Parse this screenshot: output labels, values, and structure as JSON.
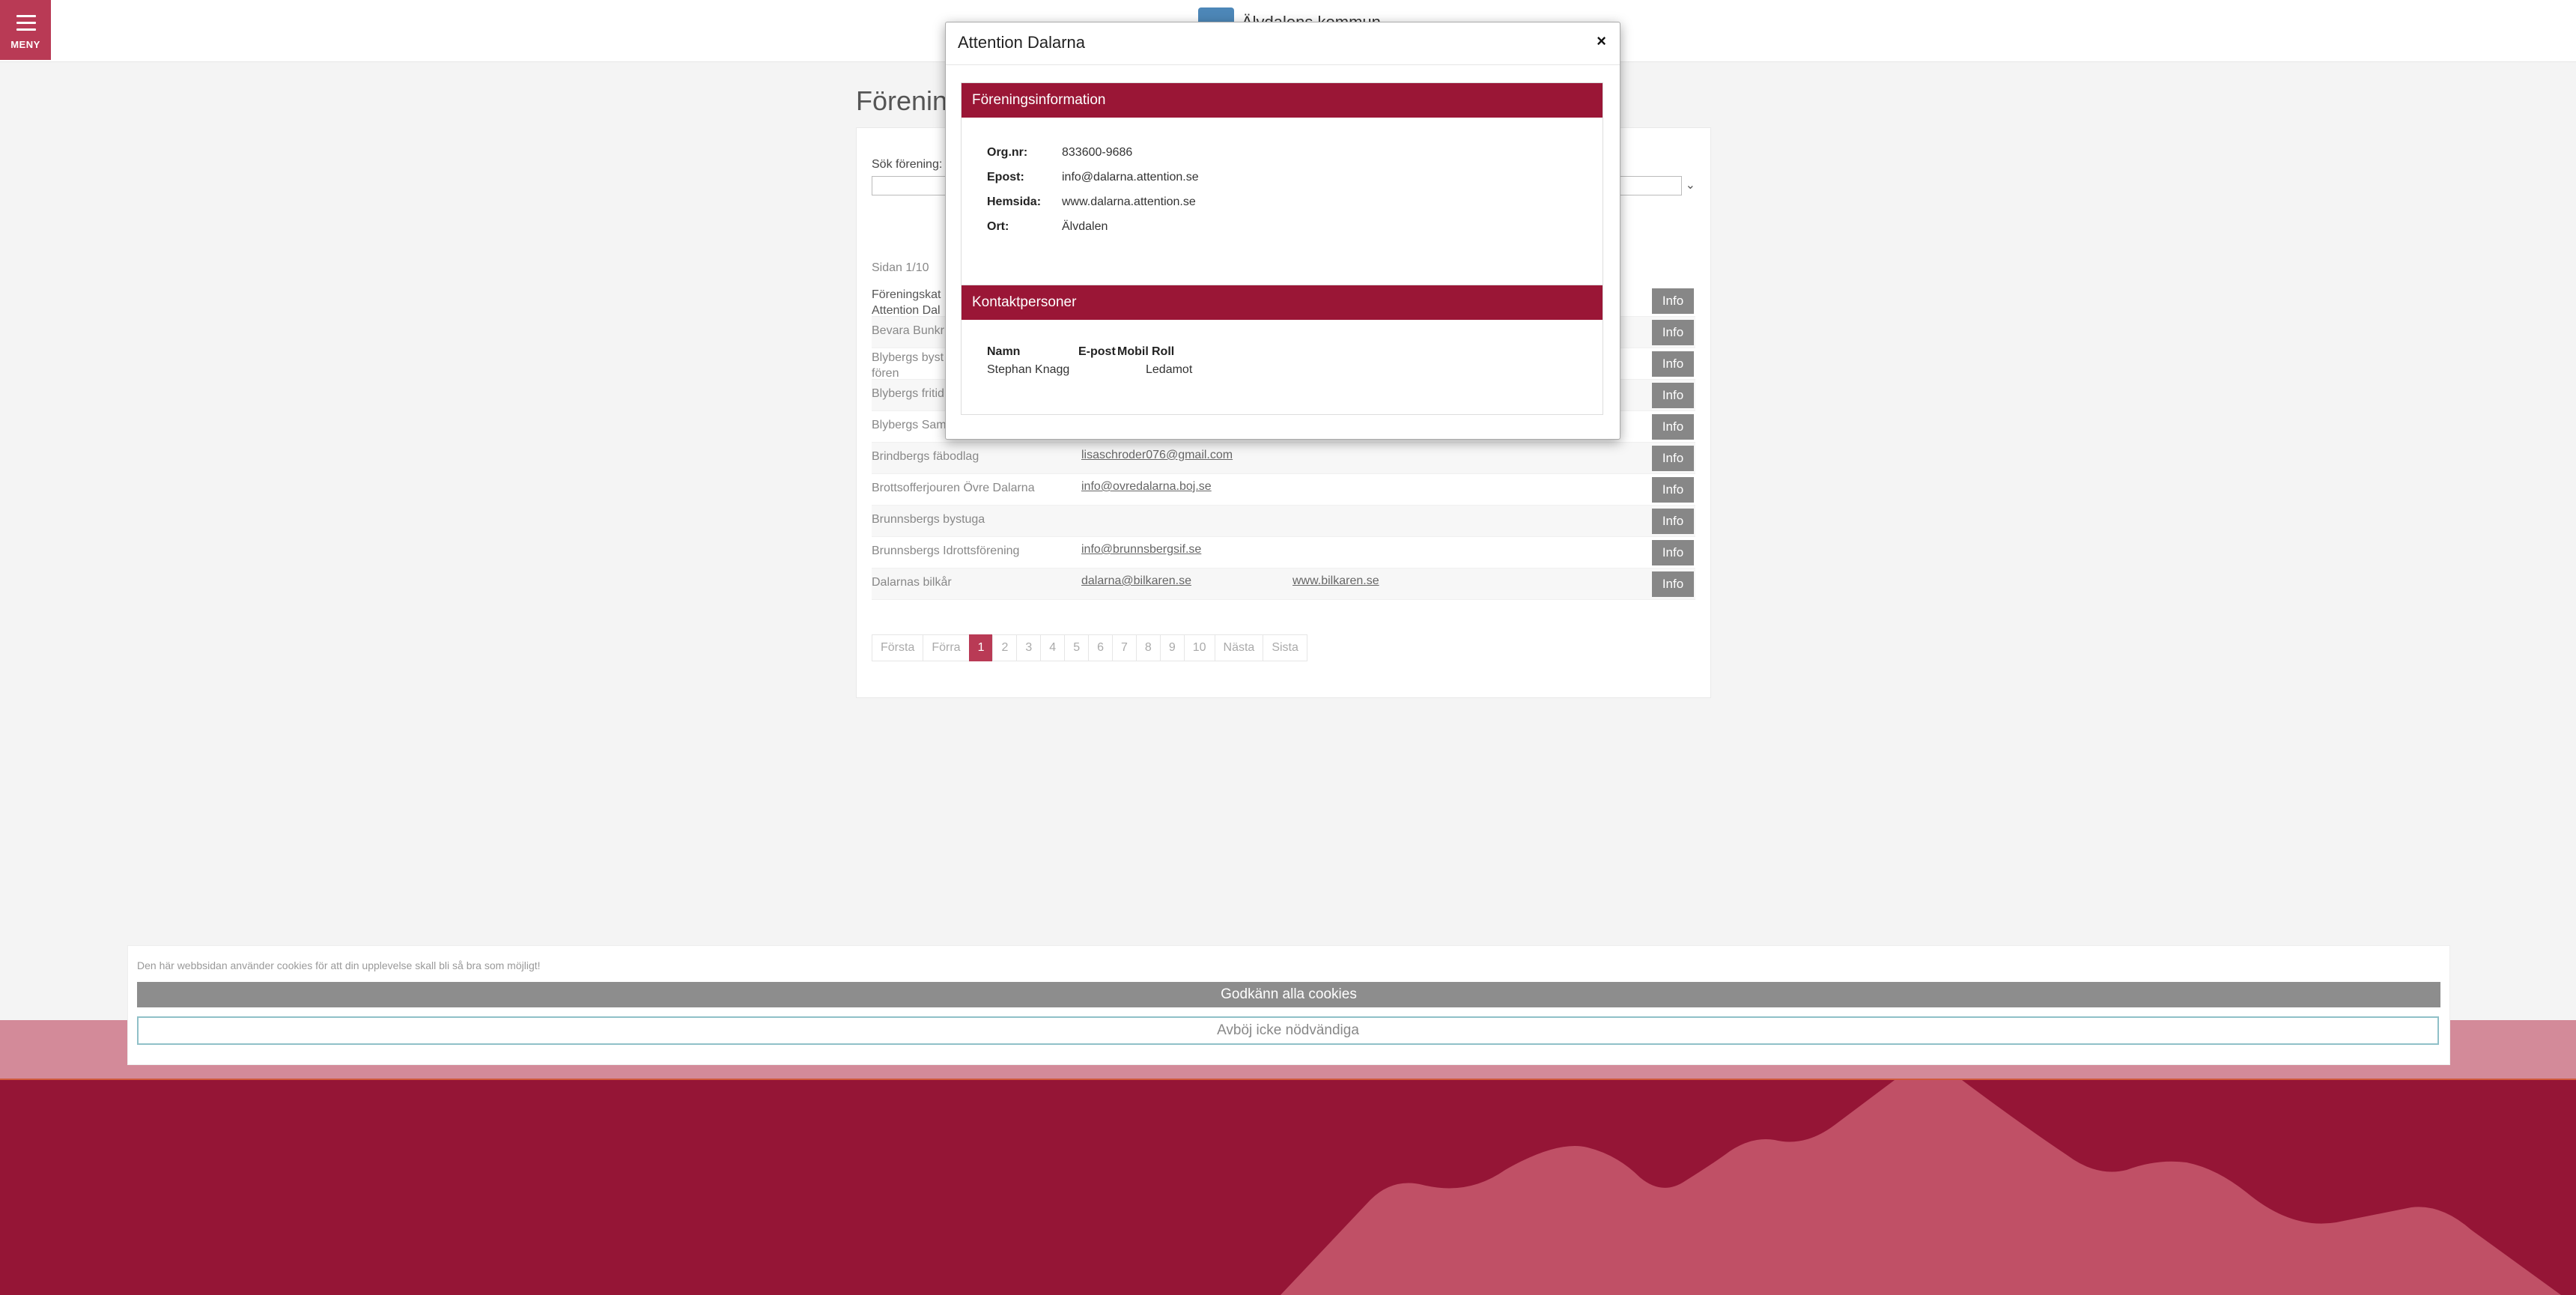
{
  "header": {
    "menu_label": "MENY",
    "logo_text": "Älvdalens kommun"
  },
  "page": {
    "title": "Förenin",
    "search_label": "Sök förening:",
    "page_count": "Sidan 1/10"
  },
  "list": {
    "info_label": "Info",
    "rows": [
      {
        "name": "Föreningskat\nAttention Dal",
        "email": "",
        "web": ""
      },
      {
        "name": "Bevara Bunkr",
        "email": "",
        "web": ""
      },
      {
        "name": "Blybergs byst\nfören",
        "email": "",
        "web": ""
      },
      {
        "name": "Blybergs fritid",
        "email": "",
        "web": ""
      },
      {
        "name": "Blybergs Samfällighetsförening",
        "email": "",
        "web": ""
      },
      {
        "name": "Brindbergs fäbodlag",
        "email": "lisaschroder076@gmail.com",
        "web": ""
      },
      {
        "name": "Brottsofferjouren Övre Dalarna",
        "email": "info@ovredalarna.boj.se",
        "web": ""
      },
      {
        "name": "Brunnsbergs bystuga",
        "email": "",
        "web": ""
      },
      {
        "name": "Brunnsbergs Idrottsförening",
        "email": "info@brunnsbergsif.se",
        "web": ""
      },
      {
        "name": "Dalarnas bilkår",
        "email": "dalarna@bilkaren.se",
        "web": "www.bilkaren.se"
      }
    ]
  },
  "pagination": [
    "Första",
    "Förra",
    "1",
    "2",
    "3",
    "4",
    "5",
    "6",
    "7",
    "8",
    "9",
    "10",
    "Nästa",
    "Sista"
  ],
  "modal": {
    "title": "Attention Dalarna",
    "close": "×",
    "info_heading": "Föreningsinformation",
    "org_label": "Org.nr:",
    "org_value": "833600-9686",
    "email_label": "Epost:",
    "email_value": "info@dalarna.attention.se",
    "web_label": "Hemsida:",
    "web_value": "www.dalarna.attention.se",
    "city_label": "Ort:",
    "city_value": "Älvdalen",
    "contacts_heading": "Kontaktpersoner",
    "col_name": "Namn",
    "col_email": "E-post",
    "col_mobile": "Mobil",
    "col_role": "Roll",
    "contact_name": "Stephan Knagg",
    "contact_role": "Ledamot"
  },
  "cookie": {
    "text": "Den här webbsidan använder cookies för att din upplevelse skall bli så bra som möjligt!",
    "accept": "Godkänn alla cookies",
    "decline": "Avböj icke nödvändiga"
  },
  "colors": {
    "brand": "#951536",
    "menu": "#b93a55",
    "accent_pink": "#d38a99"
  }
}
